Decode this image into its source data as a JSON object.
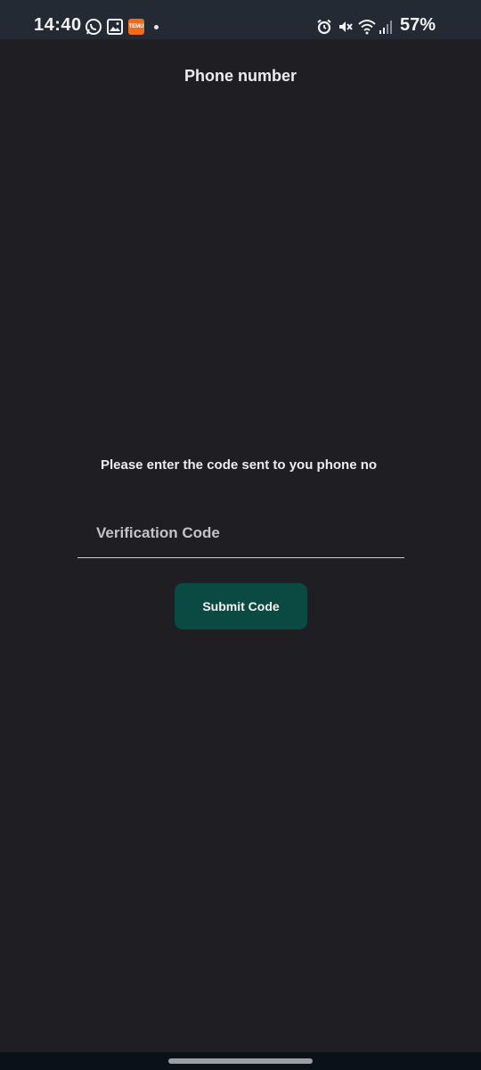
{
  "status_bar": {
    "time": "14:40",
    "battery": "57%",
    "icons": [
      "whatsapp-icon",
      "gallery-icon",
      "temu-icon",
      "notification-dot-icon",
      "alarm-icon",
      "mute-icon",
      "wifi-icon",
      "signal-icon"
    ],
    "temu_text": "TEMU"
  },
  "header": {
    "title": "Phone number"
  },
  "verification": {
    "prompt": "Please enter the code sent to you phone no",
    "placeholder": "Verification Code",
    "value": "",
    "submit_label": "Submit Code"
  },
  "colors": {
    "background": "#1f1e22",
    "status_bar": "#232a33",
    "button": "#0b4a42",
    "nav_bar": "#0b1118"
  }
}
